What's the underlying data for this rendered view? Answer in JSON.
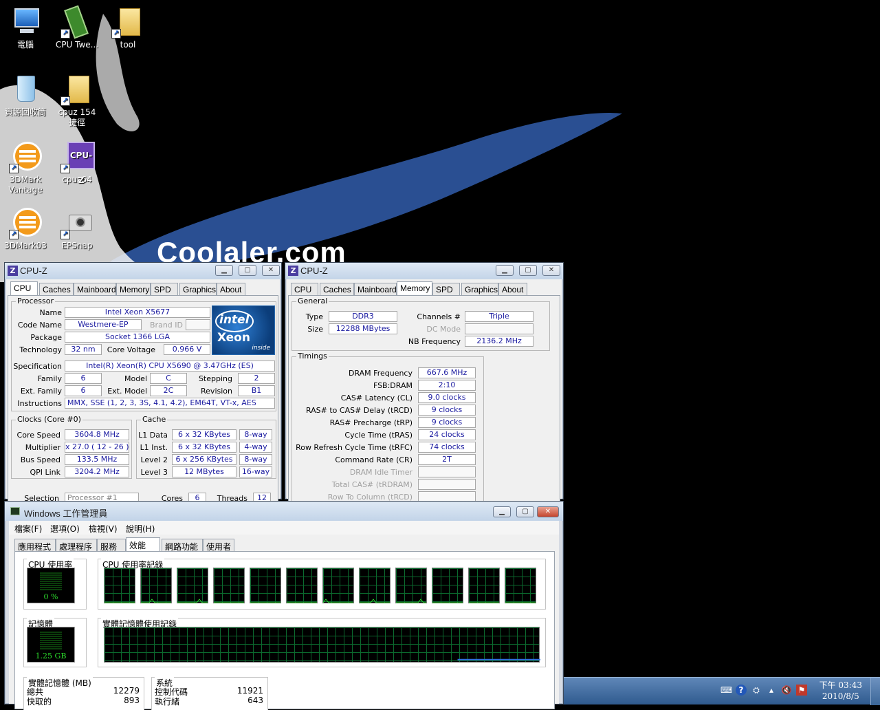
{
  "desktop": {
    "brand": "Coolaler.com",
    "icons": [
      {
        "label": "電腦",
        "icon": "computer-icon"
      },
      {
        "label": "CPU Twe...",
        "icon": "ram-module-icon"
      },
      {
        "label": "tool",
        "icon": "folder-icon"
      },
      {
        "label": "資源回收筒",
        "icon": "recycle-bin-icon"
      },
      {
        "label": "cpuz 154",
        "label2": "捷徑",
        "icon": "folder-icon"
      },
      {
        "label": "3DMark",
        "label2": "Vantage",
        "icon": "3dmark-icon"
      },
      {
        "label": "cpuz64",
        "icon": "cpuz-icon"
      },
      {
        "label": "3DMark03",
        "icon": "3dmark-icon"
      },
      {
        "label": "EPSnap",
        "icon": "camera-icon"
      }
    ]
  },
  "cpuz_cpu": {
    "title": "CPU-Z",
    "app_icon_letter": "Z",
    "buttons": {
      "min": "▁",
      "max": "▢",
      "close": "✕"
    },
    "tabs": [
      "CPU",
      "Caches",
      "Mainboard",
      "Memory",
      "SPD",
      "Graphics",
      "About"
    ],
    "active_tab": "CPU",
    "processor": {
      "group": "Processor",
      "name_label": "Name",
      "name": "Intel Xeon X5677",
      "codename_label": "Code Name",
      "codename": "Westmere-EP",
      "brandid_label": "Brand ID",
      "package_label": "Package",
      "package": "Socket 1366 LGA",
      "technology_label": "Technology",
      "technology": "32 nm",
      "voltage_label": "Core Voltage",
      "voltage": "0.966 V",
      "spec_label": "Specification",
      "spec": "Intel(R) Xeon(R) CPU           X5690  @ 3.47GHz (ES)",
      "family_label": "Family",
      "family": "6",
      "model_label": "Model",
      "model": "C",
      "stepping_label": "Stepping",
      "stepping": "2",
      "extfamily_label": "Ext. Family",
      "extfamily": "6",
      "extmodel_label": "Ext. Model",
      "extmodel": "2C",
      "revision_label": "Revision",
      "revision": "B1",
      "instructions_label": "Instructions",
      "instructions": "MMX, SSE (1, 2, 3, 3S, 4.1, 4.2), EM64T, VT-x, AES"
    },
    "logo": {
      "brand": "intel",
      "product": "Xeon",
      "tag": "inside"
    },
    "clocks": {
      "group": "Clocks (Core #0)",
      "corespeed_label": "Core Speed",
      "corespeed": "3604.8 MHz",
      "multiplier_label": "Multiplier",
      "multiplier": "x 27.0 ( 12 - 26 )",
      "busspeed_label": "Bus Speed",
      "busspeed": "133.5 MHz",
      "qpi_label": "QPI Link",
      "qpi": "3204.2 MHz"
    },
    "cache": {
      "group": "Cache",
      "l1d_label": "L1 Data",
      "l1d": "6 x 32 KBytes",
      "l1d_way": "8-way",
      "l1i_label": "L1 Inst.",
      "l1i": "6 x 32 KBytes",
      "l1i_way": "4-way",
      "l2_label": "Level 2",
      "l2": "6 x 256 KBytes",
      "l2_way": "8-way",
      "l3_label": "Level 3",
      "l3": "12 MBytes",
      "l3_way": "16-way"
    },
    "selection": {
      "label": "Selection",
      "value": "Processor #1",
      "cores_label": "Cores",
      "cores": "6",
      "threads_label": "Threads",
      "threads": "12"
    }
  },
  "cpuz_mem": {
    "title": "CPU-Z",
    "app_icon_letter": "Z",
    "buttons": {
      "min": "▁",
      "max": "▢",
      "close": "✕"
    },
    "tabs": [
      "CPU",
      "Caches",
      "Mainboard",
      "Memory",
      "SPD",
      "Graphics",
      "About"
    ],
    "active_tab": "Memory",
    "general": {
      "group": "General",
      "type_label": "Type",
      "type": "DDR3",
      "size_label": "Size",
      "size": "12288 MBytes",
      "channels_label": "Channels #",
      "channels": "Triple",
      "dcmode_label": "DC Mode",
      "nbfreq_label": "NB Frequency",
      "nbfreq": "2136.2 MHz"
    },
    "timings": {
      "group": "Timings",
      "rows": [
        {
          "label": "DRAM Frequency",
          "value": "667.6 MHz",
          "dim": false
        },
        {
          "label": "FSB:DRAM",
          "value": "2:10",
          "dim": false
        },
        {
          "label": "CAS# Latency (CL)",
          "value": "9.0 clocks",
          "dim": false
        },
        {
          "label": "RAS# to CAS# Delay (tRCD)",
          "value": "9 clocks",
          "dim": false
        },
        {
          "label": "RAS# Precharge (tRP)",
          "value": "9 clocks",
          "dim": false
        },
        {
          "label": "Cycle Time (tRAS)",
          "value": "24 clocks",
          "dim": false
        },
        {
          "label": "Row Refresh Cycle Time (tRFC)",
          "value": "74 clocks",
          "dim": false
        },
        {
          "label": "Command Rate (CR)",
          "value": "2T",
          "dim": false
        },
        {
          "label": "DRAM Idle Timer",
          "value": "",
          "dim": true
        },
        {
          "label": "Total CAS# (tRDRAM)",
          "value": "",
          "dim": true
        },
        {
          "label": "Row To Column (tRCD)",
          "value": "",
          "dim": true
        }
      ]
    }
  },
  "taskmgr": {
    "title": "Windows 工作管理員",
    "buttons": {
      "min": "▁",
      "max": "▢",
      "close": "✕"
    },
    "menus": [
      "檔案(F)",
      "選項(O)",
      "檢視(V)",
      "說明(H)"
    ],
    "tabs": [
      "應用程式",
      "處理程序",
      "服務",
      "效能",
      "網路功能",
      "使用者"
    ],
    "active_tab": "效能",
    "cpu_usage": {
      "title": "CPU 使用率",
      "value": "0 %"
    },
    "cpu_history": {
      "title": "CPU 使用率記錄",
      "cores": 12
    },
    "memory": {
      "title": "記憶體",
      "value": "1.25 GB"
    },
    "memory_history": {
      "title": "實體記憶體使用記錄",
      "used_fraction": 0.1
    },
    "physical": {
      "title": "實體記憶體 (MB)",
      "total_label": "總共",
      "total": "12279",
      "cached_label": "快取的",
      "cached": "893"
    },
    "system": {
      "title": "系統",
      "handles_label": "控制代碼",
      "handles": "11921",
      "threads_label": "執行緒",
      "threads": "643"
    }
  },
  "taskbar": {
    "clock_ampm": "下午 03:43",
    "date": "2010/8/5",
    "tray_icons": [
      "keyboard-icon",
      "help-icon",
      "network-icon",
      "arrow-icon",
      "speaker-muted-icon",
      "flag-icon"
    ]
  },
  "colors": {
    "value_text": "#1a1aa0",
    "graph_green": "#2cdc2c",
    "graph_grid": "#0b6a2e",
    "mem_line": "#2f6fe0"
  }
}
